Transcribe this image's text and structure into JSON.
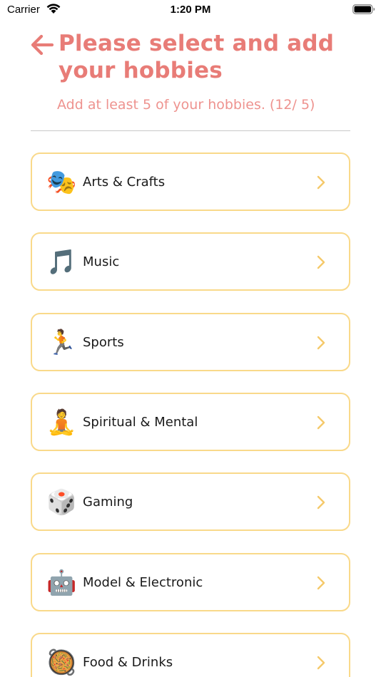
{
  "status_bar": {
    "carrier": "Carrier",
    "time": "1:20 PM"
  },
  "header": {
    "title": "Please select and add your hobbies",
    "subtitle": "Add at least 5 of your hobbies. (12/ 5)"
  },
  "colors": {
    "accent": "#e87c77",
    "card_border": "#f9d98a",
    "chevron": "#f5c96a"
  },
  "hobbies": [
    {
      "label": "Arts & Crafts",
      "icon": "performing-arts-masks-icon",
      "glyph": "🎭"
    },
    {
      "label": "Music",
      "icon": "musical-note-icon",
      "glyph": "🎵"
    },
    {
      "label": "Sports",
      "icon": "running-person-icon",
      "glyph": "🏃"
    },
    {
      "label": "Spiritual & Mental",
      "icon": "person-in-lotus-position-icon",
      "glyph": "🧘"
    },
    {
      "label": "Gaming",
      "icon": "dice-icon",
      "glyph": "🎲"
    },
    {
      "label": "Model & Electronic",
      "icon": "robot-icon",
      "glyph": "🤖"
    },
    {
      "label": "Food & Drinks",
      "icon": "paella-pan-icon",
      "glyph": "🥘"
    }
  ]
}
